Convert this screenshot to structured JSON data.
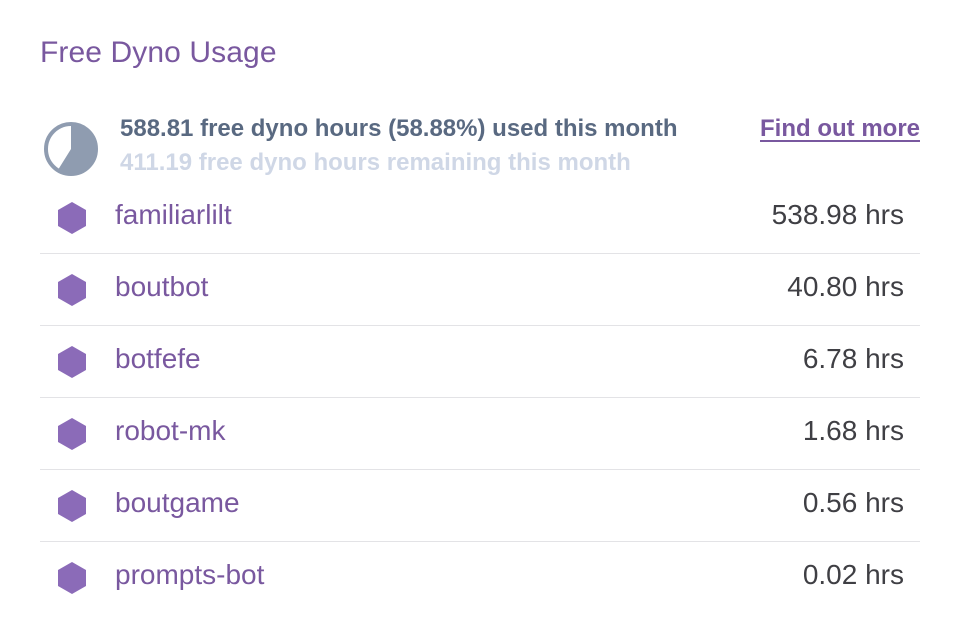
{
  "title": "Free Dyno Usage",
  "summary": {
    "used_text": "588.81 free dyno hours (58.88%) used this month",
    "remaining_text": "411.19 free dyno hours remaining this month",
    "used_fraction": 0.5888,
    "link_label": "Find out more",
    "pie_icon": "usage-pie-icon"
  },
  "colors": {
    "accent": "#79589f",
    "app_icon": "#8b6bb8",
    "pie_fill": "#8f9cb0",
    "pie_bg": "#ffffff",
    "text_dark": "#3f3f44",
    "text_muted": "#596981",
    "text_faint": "#cfd7e6"
  },
  "apps": [
    {
      "name": "familiarlilt",
      "hours": "538.98 hrs",
      "icon": "hexagon-icon"
    },
    {
      "name": "boutbot",
      "hours": "40.80 hrs",
      "icon": "hexagon-icon"
    },
    {
      "name": "botfefe",
      "hours": "6.78 hrs",
      "icon": "hexagon-icon"
    },
    {
      "name": "robot-mk",
      "hours": "1.68 hrs",
      "icon": "hexagon-icon"
    },
    {
      "name": "boutgame",
      "hours": "0.56 hrs",
      "icon": "hexagon-icon"
    },
    {
      "name": "prompts-bot",
      "hours": "0.02 hrs",
      "icon": "hexagon-icon"
    }
  ]
}
